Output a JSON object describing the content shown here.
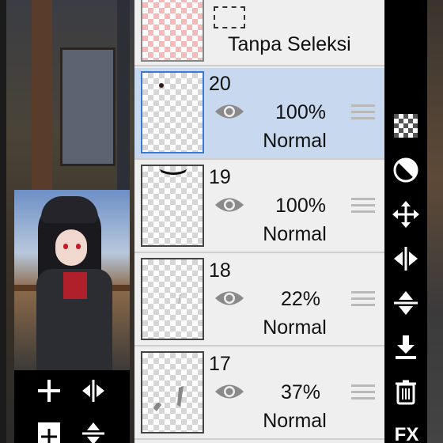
{
  "selection_layer": {
    "label": "Tanpa Seleksi"
  },
  "layers": [
    {
      "number": "20",
      "opacity": "100%",
      "blend": "Normal",
      "selected": true
    },
    {
      "number": "19",
      "opacity": "100%",
      "blend": "Normal",
      "selected": false
    },
    {
      "number": "18",
      "opacity": "22%",
      "blend": "Normal",
      "selected": false
    },
    {
      "number": "17",
      "opacity": "37%",
      "blend": "Normal",
      "selected": false
    }
  ],
  "right_toolbar": {
    "items": [
      "checker-icon",
      "circle-half-icon",
      "move-arrows-icon",
      "flip-horizontal-icon",
      "flip-vertical-icon",
      "merge-down-icon",
      "trash-icon"
    ],
    "fx_label": "FX"
  },
  "left_toolbar": {
    "items": [
      "add-layer-icon",
      "flip-horizontal-icon",
      "add-copy-icon",
      "flip-vertical-icon"
    ]
  },
  "colors": {
    "selected_row": "#c8d8ef",
    "panel": "#efefef",
    "accent": "#3a7ad6"
  }
}
